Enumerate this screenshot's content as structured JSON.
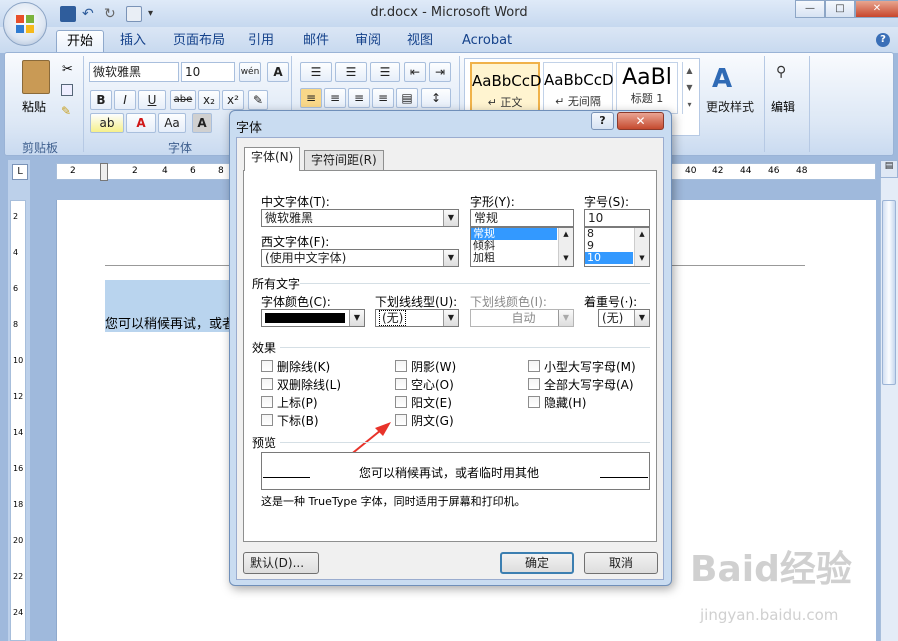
{
  "window": {
    "title": "dr.docx - Microsoft Word",
    "min": "—",
    "max": "□",
    "close": "✕"
  },
  "tabs": [
    "开始",
    "插入",
    "页面布局",
    "引用",
    "邮件",
    "审阅",
    "视图",
    "Acrobat"
  ],
  "ribbon": {
    "paste": "粘贴",
    "clipboard": "剪贴板",
    "font_group": "字体",
    "font_name": "微软雅黑",
    "font_size": "10",
    "wen": "wén",
    "bold": "B",
    "italic": "I",
    "underline": "U",
    "strike": "abe",
    "sub": "x₂",
    "sup": "x²",
    "change_case": "Aa",
    "styles": [
      {
        "sample": "AaBbCcD",
        "name": "↵ 正文"
      },
      {
        "sample": "AaBbCcD",
        "name": "↵ 无间隔"
      },
      {
        "sample": "AaBl",
        "name": "标题 1"
      }
    ],
    "change_styles": "更改样式",
    "editing": "编辑"
  },
  "document": {
    "text": "您可以稍候再试，或者"
  },
  "ruler_ticks": [
    "2",
    "2",
    "4",
    "6",
    "8",
    "40",
    "42",
    "44",
    "46",
    "48"
  ],
  "vruler_ticks": [
    "2",
    "4",
    "6",
    "8",
    "10",
    "12",
    "14",
    "16",
    "18",
    "20",
    "22",
    "24"
  ],
  "dialog": {
    "title": "字体",
    "help": "?",
    "close": "✕",
    "tab_font": "字体(N)",
    "tab_spacing": "字符间距(R)",
    "cn_font_label": "中文字体(T):",
    "cn_font": "微软雅黑",
    "west_font_label": "西文字体(F):",
    "west_font": "(使用中文字体)",
    "style_label": "字形(Y):",
    "style_value": "常规",
    "style_options": [
      "常规",
      "倾斜",
      "加粗"
    ],
    "size_label": "字号(S):",
    "size_value": "10",
    "size_options": [
      "8",
      "9",
      "10"
    ],
    "all_text": "所有文字",
    "color_label": "字体颜色(C):",
    "underline_label": "下划线线型(U):",
    "underline_value": "(无)",
    "ucolor_label": "下划线颜色(I):",
    "ucolor_value": "自动",
    "emphasis_label": "着重号(·):",
    "emphasis_value": "(无)",
    "effects": "效果",
    "effects_col1": [
      "删除线(K)",
      "双删除线(L)",
      "上标(P)",
      "下标(B)"
    ],
    "effects_col2": [
      "阴影(W)",
      "空心(O)",
      "阳文(E)",
      "阴文(G)"
    ],
    "effects_col3": [
      "小型大写字母(M)",
      "全部大写字母(A)",
      "隐藏(H)"
    ],
    "preview_label": "预览",
    "preview_text": "您可以稍候再试，或者临时用其他",
    "truetype_note": "这是一种 TrueType 字体，同时适用于屏幕和打印机。",
    "default_btn": "默认(D)...",
    "ok_btn": "确定",
    "cancel_btn": "取消"
  },
  "watermark": {
    "main": "Baid经验",
    "url": "jingyan.baidu.com"
  },
  "colors": {
    "accent": "#15428b",
    "arrow": "#e8332a",
    "selection": "#3399ff"
  }
}
